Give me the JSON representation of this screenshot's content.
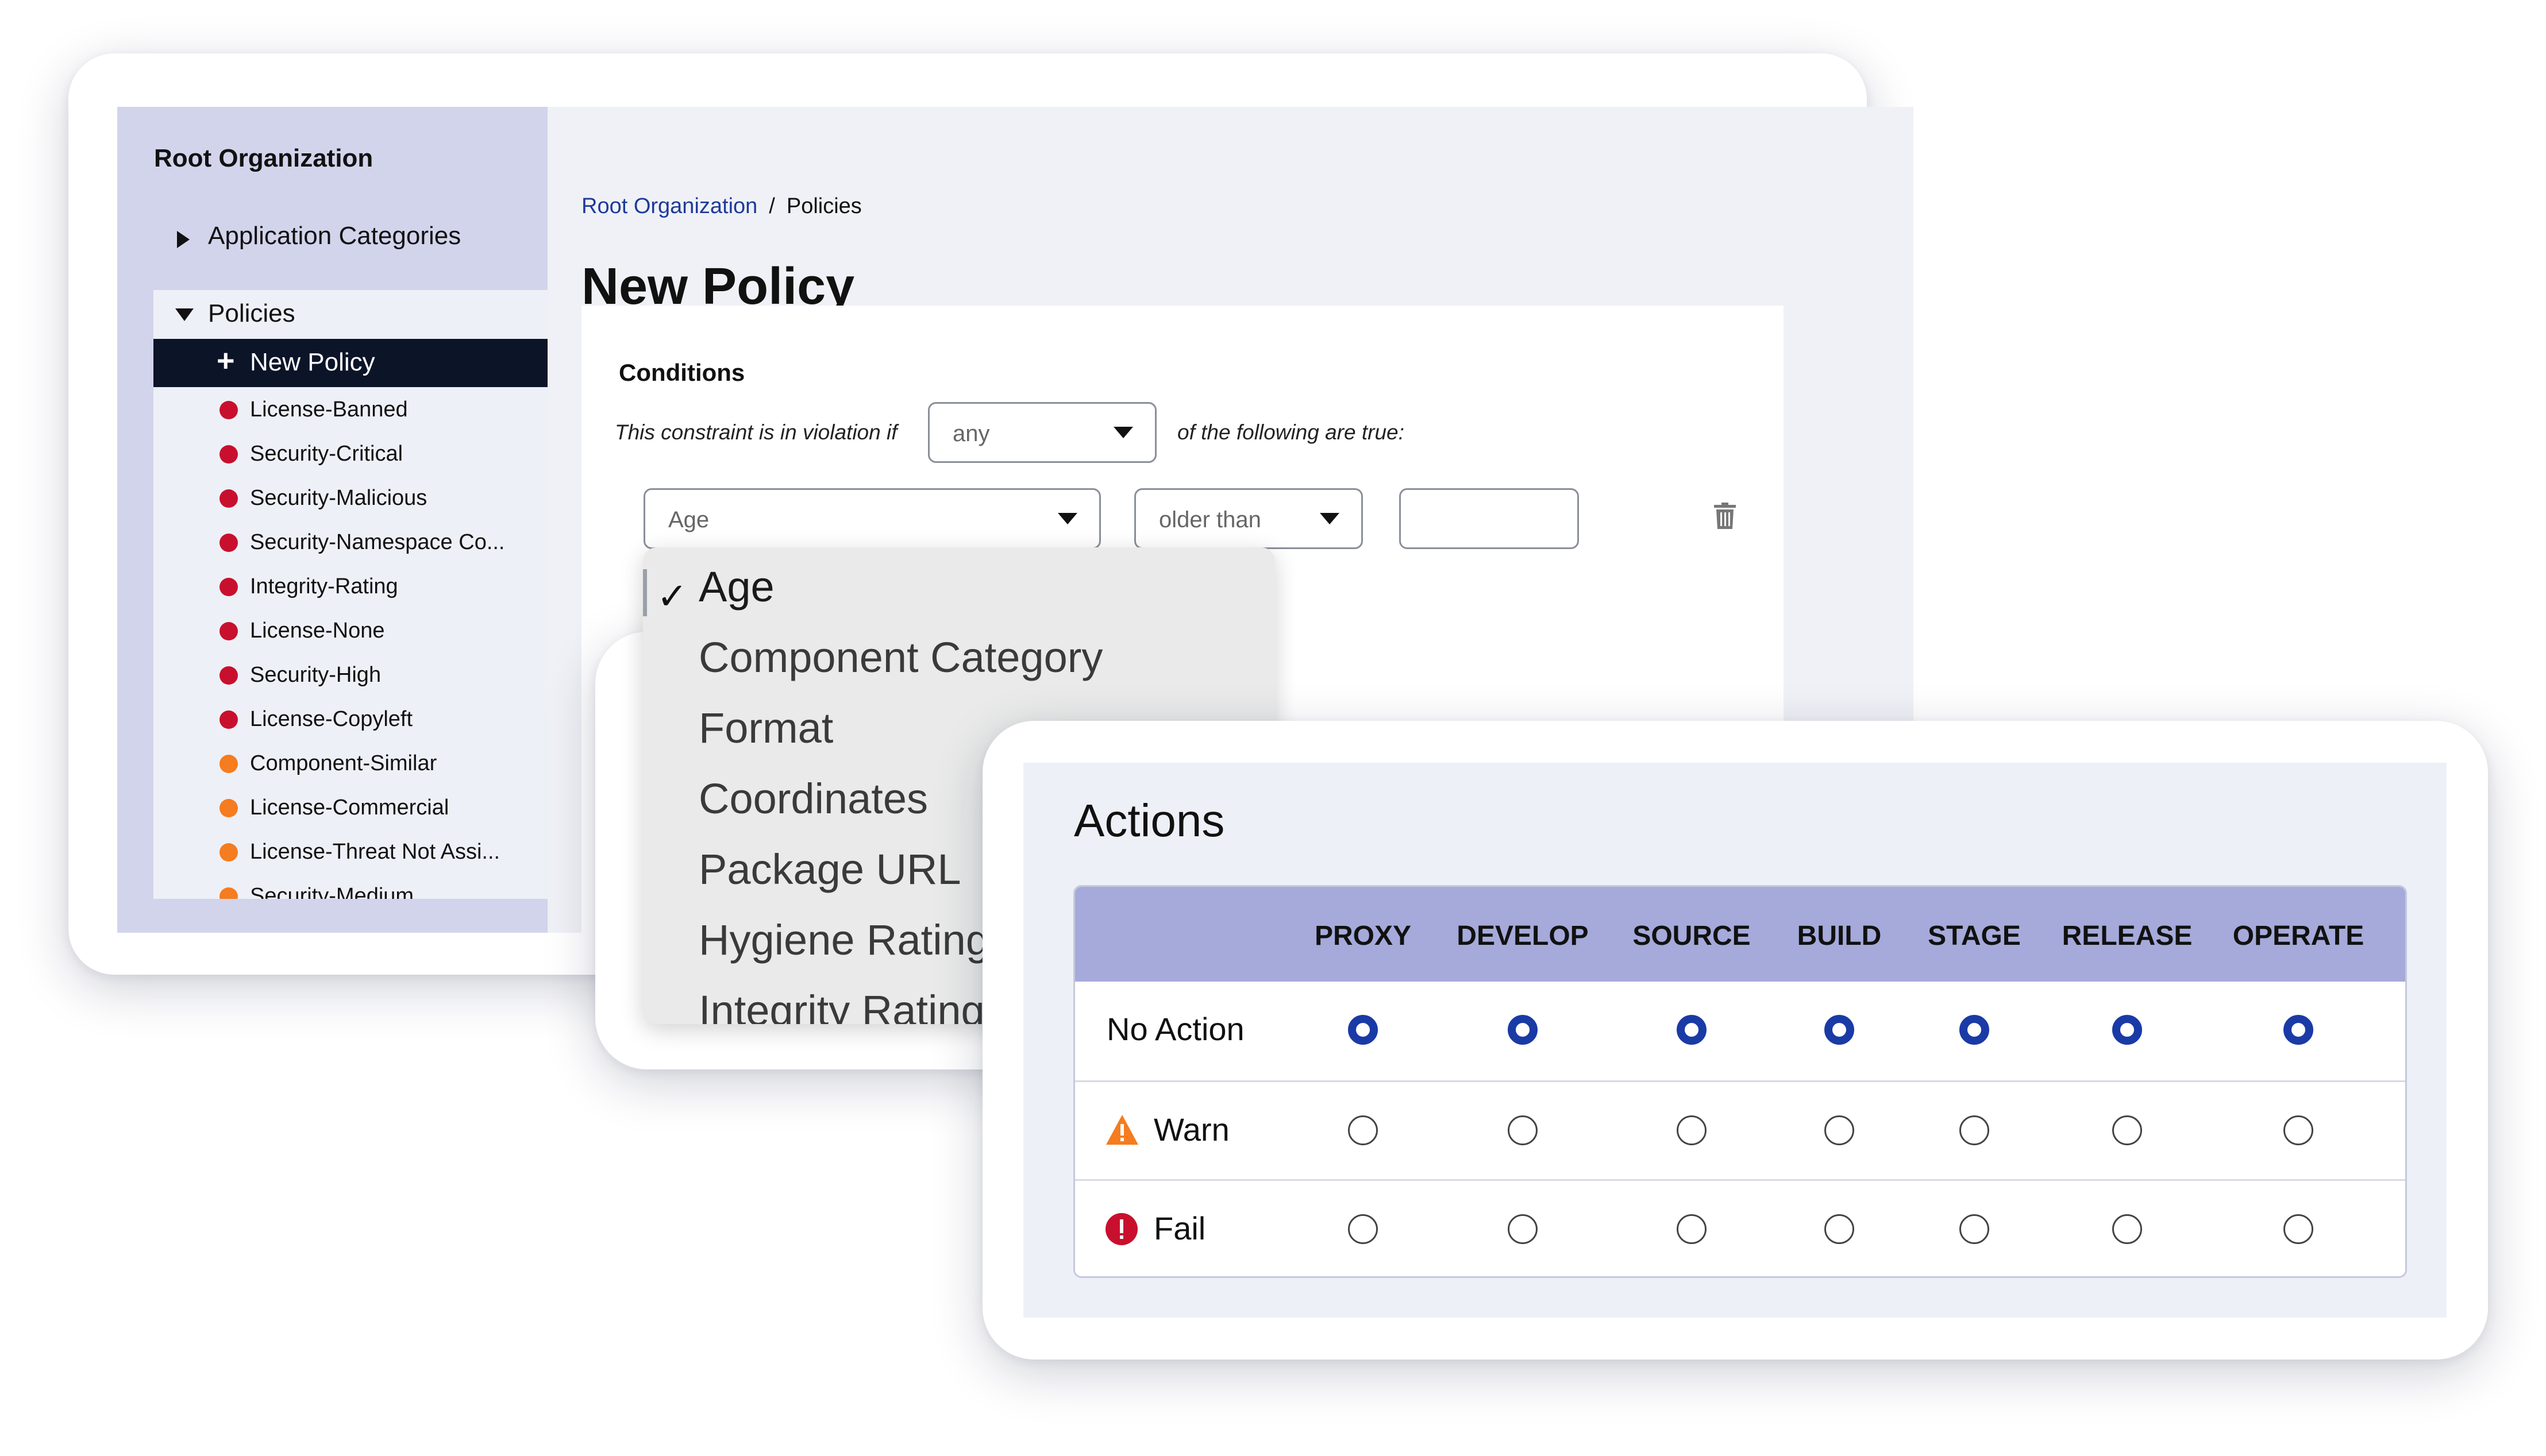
{
  "sidebar": {
    "org": "Root Organization",
    "category": "Application Categories",
    "policies": "Policies",
    "new_policy": "New Policy",
    "items": [
      {
        "label": "License-Banned",
        "color": "#c8102e"
      },
      {
        "label": "Security-Critical",
        "color": "#c8102e"
      },
      {
        "label": "Security-Malicious",
        "color": "#c8102e"
      },
      {
        "label": "Security-Namespace Co...",
        "color": "#c8102e"
      },
      {
        "label": "Integrity-Rating",
        "color": "#c8102e"
      },
      {
        "label": "License-None",
        "color": "#c8102e"
      },
      {
        "label": "Security-High",
        "color": "#c8102e"
      },
      {
        "label": "License-Copyleft",
        "color": "#c8102e"
      },
      {
        "label": "Component-Similar",
        "color": "#f57c1f"
      },
      {
        "label": "License-Commercial",
        "color": "#f57c1f"
      },
      {
        "label": "License-Threat Not Assi...",
        "color": "#f57c1f"
      },
      {
        "label": "Security-Medium",
        "color": "#f57c1f"
      }
    ]
  },
  "breadcrumb": {
    "root": "Root Organization",
    "sep": "/",
    "current": "Policies"
  },
  "page_title": "New Policy",
  "conditions": {
    "title": "Conditions",
    "sentence_start": "This constraint is in violation if",
    "match_value": "any",
    "sentence_end": "of the following are true:",
    "field_value": "Age",
    "operator_value": "older than",
    "amount_value": ""
  },
  "dropdown": {
    "options": [
      "Age",
      "Component Category",
      "Format",
      "Coordinates",
      "Package URL",
      "Hygiene Rating",
      "Integrity Rating"
    ],
    "selected": "Age"
  },
  "actions": {
    "title": "Actions",
    "columns": [
      "PROXY",
      "DEVELOP",
      "SOURCE",
      "BUILD",
      "STAGE",
      "RELEASE",
      "OPERATE"
    ],
    "rows": [
      {
        "label": "No Action",
        "icon": "none",
        "selected": [
          true,
          true,
          true,
          true,
          true,
          true,
          true
        ]
      },
      {
        "label": "Warn",
        "icon": "warning-icon",
        "icon_color": "#f57c1f",
        "selected": [
          false,
          false,
          false,
          false,
          false,
          false,
          false
        ]
      },
      {
        "label": "Fail",
        "icon": "error-icon",
        "icon_color": "#c8102e",
        "selected": [
          false,
          false,
          false,
          false,
          false,
          false,
          false
        ]
      }
    ]
  },
  "colors": {
    "accent": "#1a3aa6",
    "sidebar_bg": "#d2d4ec",
    "table_header": "#a5aadb"
  }
}
